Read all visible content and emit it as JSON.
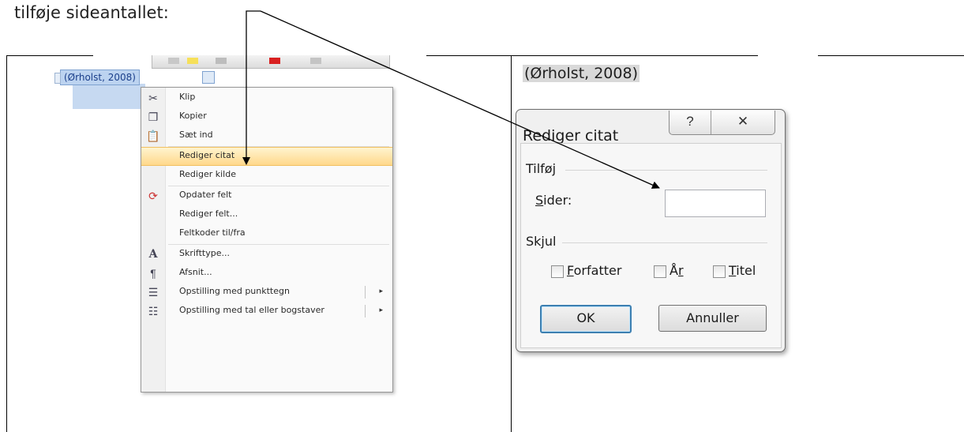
{
  "intro_text": "tilføje sideantallet:",
  "left": {
    "citation": "(Ørholst, 2008)",
    "menu_items": [
      {
        "label": "Klip",
        "icon": "scissors-icon"
      },
      {
        "label": "Kopier",
        "icon": "copy-icon"
      },
      {
        "label": "Sæt ind",
        "icon": "paste-icon"
      },
      {
        "label": "Rediger citat",
        "highlighted": true
      },
      {
        "label": "Rediger kilde"
      },
      {
        "label": "Opdater felt",
        "icon": "update-field-icon"
      },
      {
        "label": "Rediger felt..."
      },
      {
        "label": "Feltkoder til/fra"
      },
      {
        "label": "Skrifttype...",
        "icon": "font-icon"
      },
      {
        "label": "Afsnit...",
        "icon": "paragraph-icon"
      },
      {
        "label": "Opstilling med punkttegn",
        "icon": "bullets-icon",
        "submenu": true
      },
      {
        "label": "Opstilling med tal eller bogstaver",
        "icon": "numbering-icon",
        "submenu": true
      }
    ]
  },
  "right": {
    "citation": "(Ørholst, 2008)",
    "dialog": {
      "title": "Rediger citat",
      "help_glyph": "?",
      "close_glyph": "✕",
      "add_group": "Tilføj",
      "pages_label_first": "S",
      "pages_label_rest": "ider:",
      "pages_value": "",
      "hide_group": "Skjul",
      "checkboxes": {
        "author_u": "F",
        "author_rest": "orfatter",
        "year_a": "Å",
        "year_u": "r",
        "title_u": "T",
        "title_rest": "itel"
      },
      "ok_label": "OK",
      "cancel_label": "Annuller"
    }
  }
}
